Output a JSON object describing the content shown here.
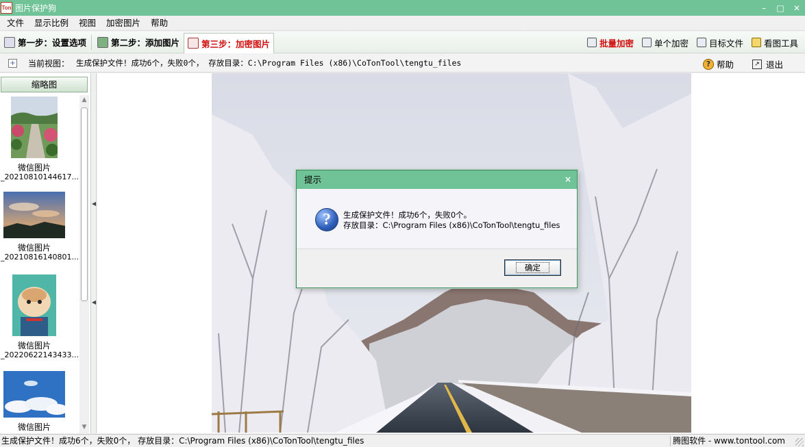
{
  "window": {
    "title": "图片保护狗",
    "app_icon_text": "Ton",
    "controls": {
      "minimize": "–",
      "maximize": "□",
      "close": "✕"
    }
  },
  "menu": [
    "文件",
    "显示比例",
    "视图",
    "加密图片",
    "帮助"
  ],
  "steps": [
    {
      "label": "第一步：设置选项",
      "icon": "gear-settings-icon",
      "active": false
    },
    {
      "label": "第二步：添加图片",
      "icon": "picture-icon",
      "active": false
    },
    {
      "label": "第三步：加密图片",
      "icon": "encrypt-icon",
      "active": true
    }
  ],
  "tools": [
    {
      "label": "批量加密",
      "icon": "batch-encrypt-icon",
      "highlight": true
    },
    {
      "label": "单个加密",
      "icon": "single-encrypt-icon",
      "highlight": false
    },
    {
      "label": "目标文件",
      "icon": "target-file-icon",
      "highlight": false
    },
    {
      "label": "看图工具",
      "icon": "viewer-tool-icon",
      "highlight": false
    }
  ],
  "infobar": {
    "label": "当前视图：",
    "text": "生成保护文件！成功6个，失败0个，  存放目录：C:\\Program Files (x86)\\CoTonTool\\tengtu_files",
    "help": "帮助",
    "exit": "退出"
  },
  "thumbnails": {
    "header": "缩略图",
    "items": [
      {
        "name": "微信图片",
        "sub": "_20210810144617..."
      },
      {
        "name": "微信图片",
        "sub": "_20210816140801..."
      },
      {
        "name": "微信图片",
        "sub": "_20220622143433..."
      },
      {
        "name": "微信图片",
        "sub": ""
      }
    ]
  },
  "dialog": {
    "title": "提示",
    "close": "×",
    "line1": "生成保护文件！成功6个，失败0个。",
    "line2": "存放目录：C:\\Program Files (x86)\\CoTonTool\\tengtu_files",
    "ok": "确定"
  },
  "status": {
    "left": "生成保护文件！成功6个，失败0个，  存放目录：C:\\Program Files (x86)\\CoTonTool\\tengtu_files",
    "right": "腾图软件 - www.tontool.com"
  },
  "colors": {
    "titlebar": "#6fc397",
    "active_step": "#d01010"
  }
}
